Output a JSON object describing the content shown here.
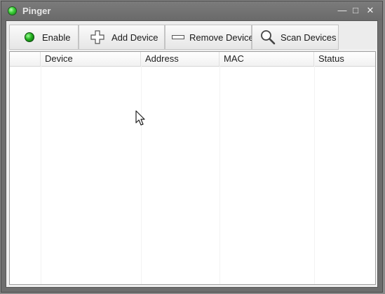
{
  "window": {
    "title": "Pinger"
  },
  "window_controls": {
    "minimize": "—",
    "maximize": "□",
    "close": "✕"
  },
  "toolbar": {
    "enable_label": "Enable",
    "add_device_label": "Add Device",
    "remove_device_label": "Remove Device",
    "scan_devices_label": "Scan Devices"
  },
  "device_table": {
    "columns": [
      "",
      "Device",
      "Address",
      "MAC",
      "Status"
    ],
    "rows": []
  },
  "icons": {
    "app": "green-status-dot-icon",
    "enable": "green-status-dot-icon",
    "add": "plus-icon",
    "remove": "minus-icon",
    "scan": "magnifier-icon"
  },
  "colors": {
    "accent_green": "#23b01f"
  }
}
